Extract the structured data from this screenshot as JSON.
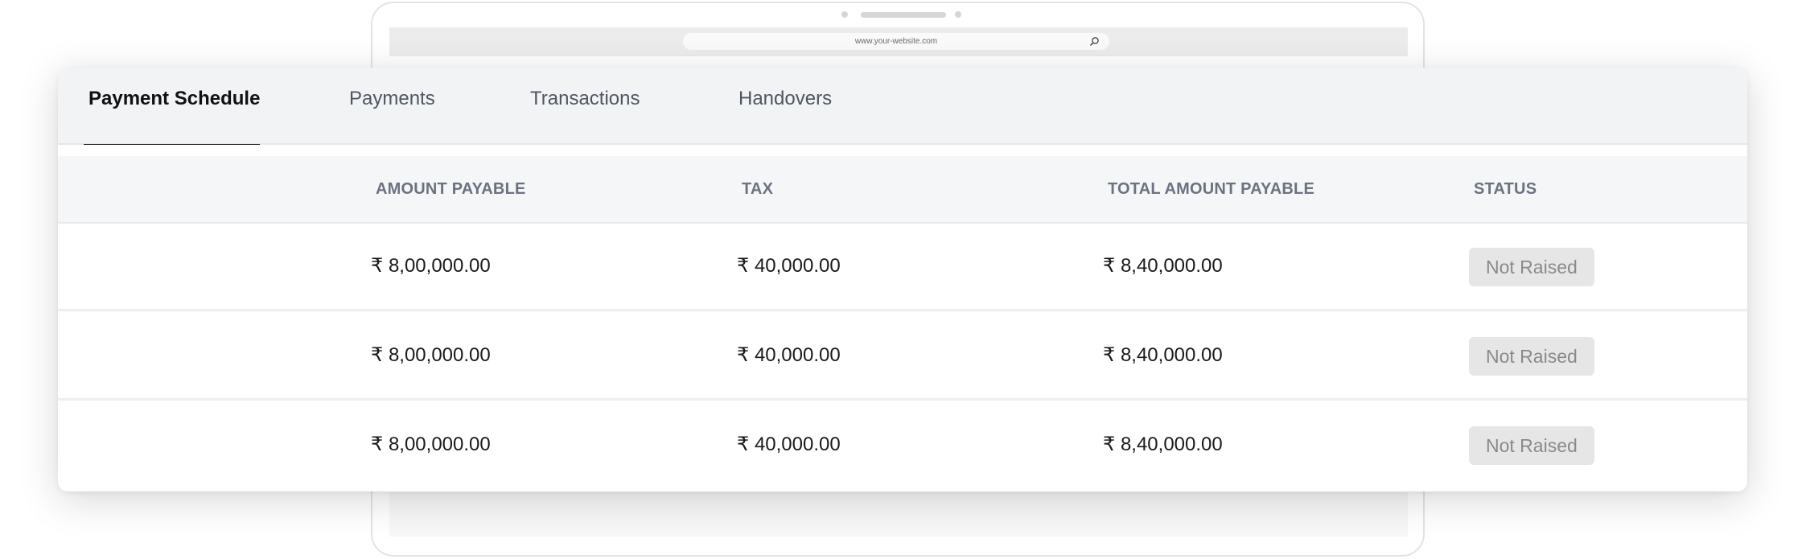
{
  "browser": {
    "url": "www.your-website.com"
  },
  "tabs": [
    {
      "label": "Payment Schedule",
      "active": true
    },
    {
      "label": "Payments",
      "active": false
    },
    {
      "label": "Transactions",
      "active": false
    },
    {
      "label": "Handovers",
      "active": false
    }
  ],
  "table": {
    "headers": [
      "AMOUNT PAYABLE",
      "TAX",
      "TOTAL AMOUNT PAYABLE",
      "STATUS"
    ],
    "rows": [
      {
        "amount": "₹ 8,00,000.00",
        "tax": "₹ 40,000.00",
        "total": "₹ 8,40,000.00",
        "status": "Not Raised"
      },
      {
        "amount": "₹ 8,00,000.00",
        "tax": "₹ 40,000.00",
        "total": "₹ 8,40,000.00",
        "status": "Not Raised"
      },
      {
        "amount": "₹ 8,00,000.00",
        "tax": "₹ 40,000.00",
        "total": "₹ 8,40,000.00",
        "status": "Not Raised"
      }
    ]
  },
  "colors": {
    "tab_bar_bg": "#f2f3f5",
    "active_tab_indicator": "#111111",
    "header_text": "#6b7280",
    "badge_bg": "#e6e6e6",
    "badge_text": "#8a8a8a"
  }
}
